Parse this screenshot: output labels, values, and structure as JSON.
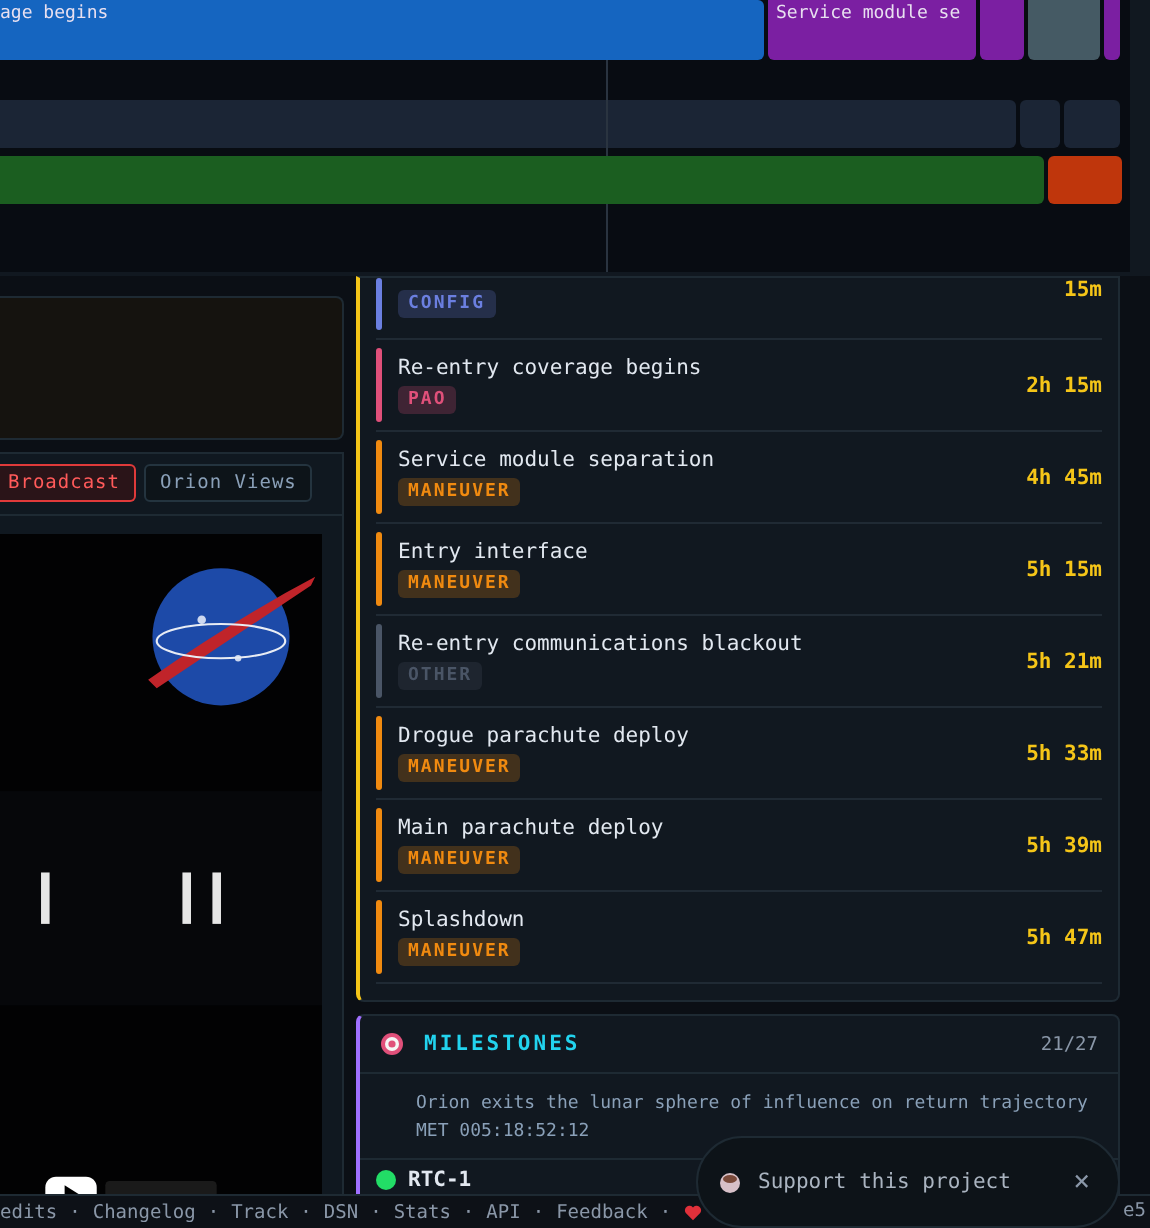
{
  "timeline": {
    "rows": [
      {
        "segments": [
          {
            "label": "age begins",
            "color": "#1565c0"
          },
          {
            "label": "Service module se",
            "color": "#7b1fa2"
          },
          {
            "color": "#7b1fa2"
          },
          {
            "color": "#455a64"
          },
          {
            "color": "#7b1fa2"
          }
        ]
      },
      {
        "segments": [
          {
            "color": "#1b2535"
          },
          {
            "color": "#1b2535"
          },
          {
            "color": "#1b2535"
          }
        ]
      },
      {
        "segments": [
          {
            "color": "#1b5e20"
          },
          {
            "color": "#bf360c"
          }
        ]
      }
    ]
  },
  "video_tabs": [
    {
      "label": "Broadcast",
      "selected": true
    },
    {
      "label": "Orion Views",
      "selected": false
    }
  ],
  "events": [
    {
      "tag": "CONFIG",
      "color": "#6b7fe0",
      "time": "15m"
    },
    {
      "title": "Re-entry coverage begins",
      "tag": "PAO",
      "color": "#e0507a",
      "time": "2h 15m"
    },
    {
      "title": "Service module separation",
      "tag": "MANEUVER",
      "color": "#f08a10",
      "time": "4h 45m"
    },
    {
      "title": "Entry interface",
      "tag": "MANEUVER",
      "color": "#f08a10",
      "time": "5h 15m"
    },
    {
      "title": "Re-entry communications blackout",
      "tag": "OTHER",
      "color": "#4a5566",
      "time": "5h 21m"
    },
    {
      "title": "Drogue parachute deploy",
      "tag": "MANEUVER",
      "color": "#f08a10",
      "time": "5h 33m"
    },
    {
      "title": "Main parachute deploy",
      "tag": "MANEUVER",
      "color": "#f08a10",
      "time": "5h 39m"
    },
    {
      "title": "Splashdown",
      "tag": "MANEUVER",
      "color": "#f08a10",
      "time": "5h 47m"
    }
  ],
  "milestones": {
    "title": "MILESTONES",
    "count": "21/27",
    "description": "Orion exits the lunar sphere of influence on return trajectory",
    "met": "MET 005:18:52:12",
    "next": {
      "name": "RTC-1",
      "color": "#22dd66"
    }
  },
  "support": {
    "label": "Support this project",
    "close": "×"
  },
  "footer": {
    "links": [
      "edits",
      "Changelog",
      "Track",
      "DSN",
      "Stats",
      "API",
      "Feedback"
    ],
    "separator": "·",
    "trailing": "e5"
  }
}
